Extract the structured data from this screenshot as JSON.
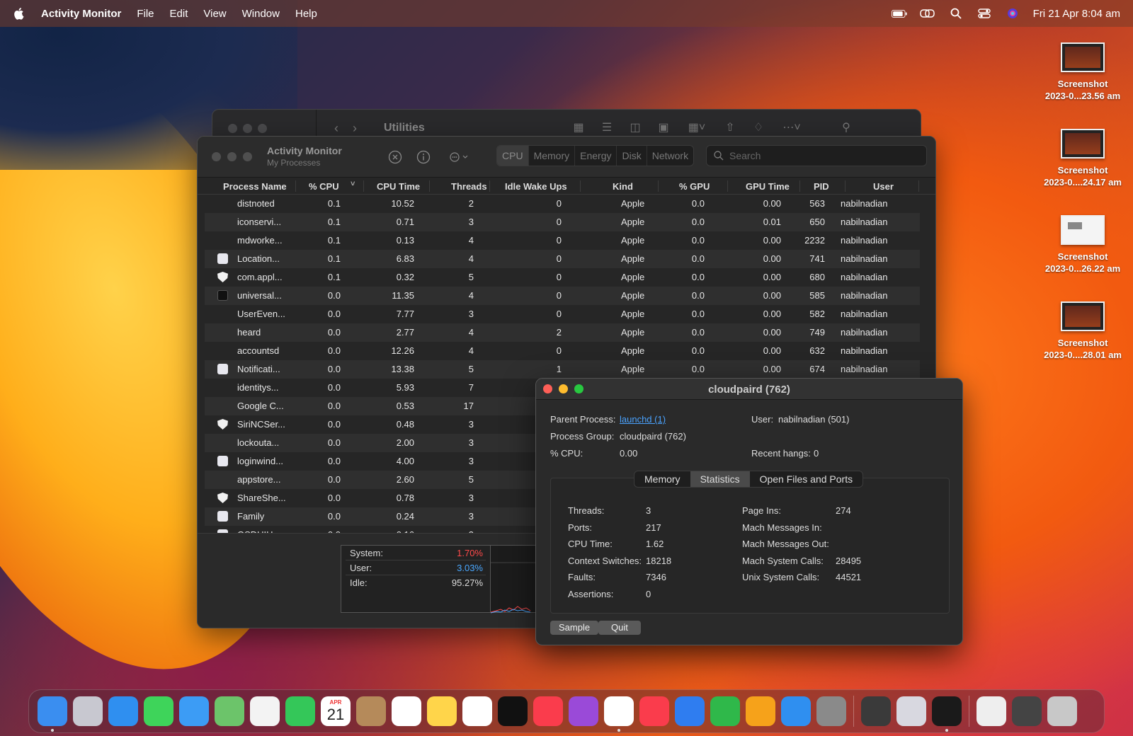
{
  "menubar": {
    "app": "Activity Monitor",
    "menus": [
      "File",
      "Edit",
      "View",
      "Window",
      "Help"
    ],
    "datetime": "Fri 21 Apr  8:04 am"
  },
  "desktop": {
    "icons": [
      {
        "line1": "Screenshot",
        "line2": "2023-0...23.56 am"
      },
      {
        "line1": "Screenshot",
        "line2": "2023-0....24.17 am"
      },
      {
        "line1": "Screenshot",
        "line2": "2023-0...26.22 am"
      },
      {
        "line1": "Screenshot",
        "line2": "2023-0....28.01 am"
      }
    ]
  },
  "finder": {
    "title": "Utilities"
  },
  "activity": {
    "title": "Activity Monitor",
    "subtitle": "My Processes",
    "tabs": [
      "CPU",
      "Memory",
      "Energy",
      "Disk",
      "Network"
    ],
    "active_tab": "CPU",
    "search_placeholder": "Search",
    "columns": [
      "Process Name",
      "% CPU",
      "CPU Time",
      "Threads",
      "Idle Wake Ups",
      "Kind",
      "% GPU",
      "GPU Time",
      "PID",
      "User"
    ],
    "rows": [
      {
        "icon": "",
        "name": "distnoted",
        "cpu": "0.1",
        "time": "10.52",
        "threads": "2",
        "idle": "0",
        "kind": "Apple",
        "gpu": "0.0",
        "gtime": "0.00",
        "pid": "563",
        "user": "nabilnadian"
      },
      {
        "icon": "",
        "name": "iconservi...",
        "cpu": "0.1",
        "time": "0.71",
        "threads": "3",
        "idle": "0",
        "kind": "Apple",
        "gpu": "0.0",
        "gtime": "0.01",
        "pid": "650",
        "user": "nabilnadian"
      },
      {
        "icon": "",
        "name": "mdworke...",
        "cpu": "0.1",
        "time": "0.13",
        "threads": "4",
        "idle": "0",
        "kind": "Apple",
        "gpu": "0.0",
        "gtime": "0.00",
        "pid": "2232",
        "user": "nabilnadian"
      },
      {
        "icon": "sq",
        "name": "Location...",
        "cpu": "0.1",
        "time": "6.83",
        "threads": "4",
        "idle": "0",
        "kind": "Apple",
        "gpu": "0.0",
        "gtime": "0.00",
        "pid": "741",
        "user": "nabilnadian"
      },
      {
        "icon": "shield",
        "name": "com.appl...",
        "cpu": "0.1",
        "time": "0.32",
        "threads": "5",
        "idle": "0",
        "kind": "Apple",
        "gpu": "0.0",
        "gtime": "0.00",
        "pid": "680",
        "user": "nabilnadian"
      },
      {
        "icon": "term",
        "name": "universal...",
        "cpu": "0.0",
        "time": "11.35",
        "threads": "4",
        "idle": "0",
        "kind": "Apple",
        "gpu": "0.0",
        "gtime": "0.00",
        "pid": "585",
        "user": "nabilnadian"
      },
      {
        "icon": "",
        "name": "UserEven...",
        "cpu": "0.0",
        "time": "7.77",
        "threads": "3",
        "idle": "0",
        "kind": "Apple",
        "gpu": "0.0",
        "gtime": "0.00",
        "pid": "582",
        "user": "nabilnadian"
      },
      {
        "icon": "",
        "name": "heard",
        "cpu": "0.0",
        "time": "2.77",
        "threads": "4",
        "idle": "2",
        "kind": "Apple",
        "gpu": "0.0",
        "gtime": "0.00",
        "pid": "749",
        "user": "nabilnadian"
      },
      {
        "icon": "",
        "name": "accountsd",
        "cpu": "0.0",
        "time": "12.26",
        "threads": "4",
        "idle": "0",
        "kind": "Apple",
        "gpu": "0.0",
        "gtime": "0.00",
        "pid": "632",
        "user": "nabilnadian"
      },
      {
        "icon": "sq",
        "name": "Notificati...",
        "cpu": "0.0",
        "time": "13.38",
        "threads": "5",
        "idle": "1",
        "kind": "Apple",
        "gpu": "0.0",
        "gtime": "0.00",
        "pid": "674",
        "user": "nabilnadian"
      },
      {
        "icon": "",
        "name": "identitys...",
        "cpu": "0.0",
        "time": "5.93",
        "threads": "7",
        "idle": "",
        "kind": "",
        "gpu": "",
        "gtime": "",
        "pid": "",
        "user": ""
      },
      {
        "icon": "",
        "name": "Google C...",
        "cpu": "0.0",
        "time": "0.53",
        "threads": "17",
        "idle": "",
        "kind": "",
        "gpu": "",
        "gtime": "",
        "pid": "",
        "user": ""
      },
      {
        "icon": "shield",
        "name": "SiriNCSer...",
        "cpu": "0.0",
        "time": "0.48",
        "threads": "3",
        "idle": "",
        "kind": "",
        "gpu": "",
        "gtime": "",
        "pid": "",
        "user": ""
      },
      {
        "icon": "",
        "name": "lockouta...",
        "cpu": "0.0",
        "time": "2.00",
        "threads": "3",
        "idle": "",
        "kind": "",
        "gpu": "",
        "gtime": "",
        "pid": "",
        "user": ""
      },
      {
        "icon": "sq",
        "name": "loginwind...",
        "cpu": "0.0",
        "time": "4.00",
        "threads": "3",
        "idle": "",
        "kind": "",
        "gpu": "",
        "gtime": "",
        "pid": "",
        "user": ""
      },
      {
        "icon": "",
        "name": "appstore...",
        "cpu": "0.0",
        "time": "2.60",
        "threads": "5",
        "idle": "",
        "kind": "",
        "gpu": "",
        "gtime": "",
        "pid": "",
        "user": ""
      },
      {
        "icon": "shield",
        "name": "ShareShe...",
        "cpu": "0.0",
        "time": "0.78",
        "threads": "3",
        "idle": "",
        "kind": "",
        "gpu": "",
        "gtime": "",
        "pid": "",
        "user": ""
      },
      {
        "icon": "sq",
        "name": "Family",
        "cpu": "0.0",
        "time": "0.24",
        "threads": "3",
        "idle": "",
        "kind": "",
        "gpu": "",
        "gtime": "",
        "pid": "",
        "user": ""
      },
      {
        "icon": "sq",
        "name": "OSDUIHe...",
        "cpu": "0.0",
        "time": "0.16",
        "threads": "3",
        "idle": "",
        "kind": "",
        "gpu": "",
        "gtime": "",
        "pid": "",
        "user": ""
      }
    ],
    "summary": {
      "system_label": "System:",
      "system_value": "1.70%",
      "user_label": "User:",
      "user_value": "3.03%",
      "idle_label": "Idle:",
      "idle_value": "95.27%"
    },
    "colors": {
      "system": "#ff4a4a",
      "user": "#4aa8ff"
    }
  },
  "info": {
    "title": "cloudpaird (762)",
    "parent_label": "Parent Process:",
    "parent_value": "launchd (1)",
    "user_label": "User:",
    "user_value": "nabilnadian (501)",
    "group_label": "Process Group:",
    "group_value": "cloudpaird (762)",
    "cpu_label": "% CPU:",
    "cpu_value": "0.00",
    "hangs_label": "Recent hangs:",
    "hangs_value": "0",
    "tabs": [
      "Memory",
      "Statistics",
      "Open Files and Ports"
    ],
    "active_tab": "Statistics",
    "stats_left": [
      {
        "label": "Threads:",
        "value": "3"
      },
      {
        "label": "Ports:",
        "value": "217"
      },
      {
        "label": "CPU Time:",
        "value": "1.62"
      },
      {
        "label": "Context Switches:",
        "value": "18218"
      },
      {
        "label": "Faults:",
        "value": "7346"
      },
      {
        "label": "Assertions:",
        "value": "0"
      }
    ],
    "stats_right": [
      {
        "label": "Page Ins:",
        "value": "274"
      },
      {
        "label": "Mach Messages In:",
        "value": ""
      },
      {
        "label": "Mach Messages Out:",
        "value": ""
      },
      {
        "label": "Mach System Calls:",
        "value": "28495"
      },
      {
        "label": "Unix System Calls:",
        "value": "44521"
      }
    ],
    "sample_button": "Sample",
    "quit_button": "Quit"
  },
  "dock": {
    "calendar_month": "APR",
    "calendar_day": "21",
    "apps": [
      {
        "name": "finder-icon",
        "color": "#3a8ef0",
        "running": true
      },
      {
        "name": "launchpad-icon",
        "color": "#c8c8d0",
        "running": false
      },
      {
        "name": "safari-icon",
        "color": "#2f8ff0",
        "running": false
      },
      {
        "name": "messages-icon",
        "color": "#3ed45a",
        "running": false
      },
      {
        "name": "mail-icon",
        "color": "#3c9cf5",
        "running": false
      },
      {
        "name": "maps-icon",
        "color": "#6cc46a",
        "running": false
      },
      {
        "name": "photos-icon",
        "color": "#f3f3f3",
        "running": false
      },
      {
        "name": "facetime-icon",
        "color": "#34c759",
        "running": false
      },
      {
        "name": "calendar-icon",
        "color": "#ffffff",
        "running": false
      },
      {
        "name": "contacts-icon",
        "color": "#b58a5a",
        "running": false
      },
      {
        "name": "reminders-icon",
        "color": "#ffffff",
        "running": false
      },
      {
        "name": "notes-icon",
        "color": "#ffd54a",
        "running": false
      },
      {
        "name": "freeform-icon",
        "color": "#ffffff",
        "running": false
      },
      {
        "name": "apple-tv-icon",
        "color": "#111111",
        "running": false
      },
      {
        "name": "music-icon",
        "color": "#fa3c4c",
        "running": false
      },
      {
        "name": "podcasts-icon",
        "color": "#9a4ad8",
        "running": false
      },
      {
        "name": "chrome-icon",
        "color": "#ffffff",
        "running": true
      },
      {
        "name": "news-icon",
        "color": "#fa3c4c",
        "running": false
      },
      {
        "name": "keynote-icon",
        "color": "#2f7df0",
        "running": false
      },
      {
        "name": "numbers-icon",
        "color": "#2fb84a",
        "running": false
      },
      {
        "name": "pages-icon",
        "color": "#f6a21a",
        "running": false
      },
      {
        "name": "app-store-icon",
        "color": "#2f8ff0",
        "running": false
      },
      {
        "name": "system-settings-icon",
        "color": "#8a8a8a",
        "running": false
      }
    ],
    "apps2": [
      {
        "name": "fl-studio-icon",
        "color": "#3a3a3a",
        "running": false
      },
      {
        "name": "preview-icon",
        "color": "#d8d8e0",
        "running": false
      },
      {
        "name": "activity-monitor-icon",
        "color": "#1a1a1a",
        "running": true
      }
    ],
    "apps3": [
      {
        "name": "document-icon",
        "color": "#eeeeee",
        "running": false
      },
      {
        "name": "downloads-stack-icon",
        "color": "#444444",
        "running": false
      },
      {
        "name": "trash-icon",
        "color": "#c8c8c8",
        "running": false
      }
    ]
  }
}
